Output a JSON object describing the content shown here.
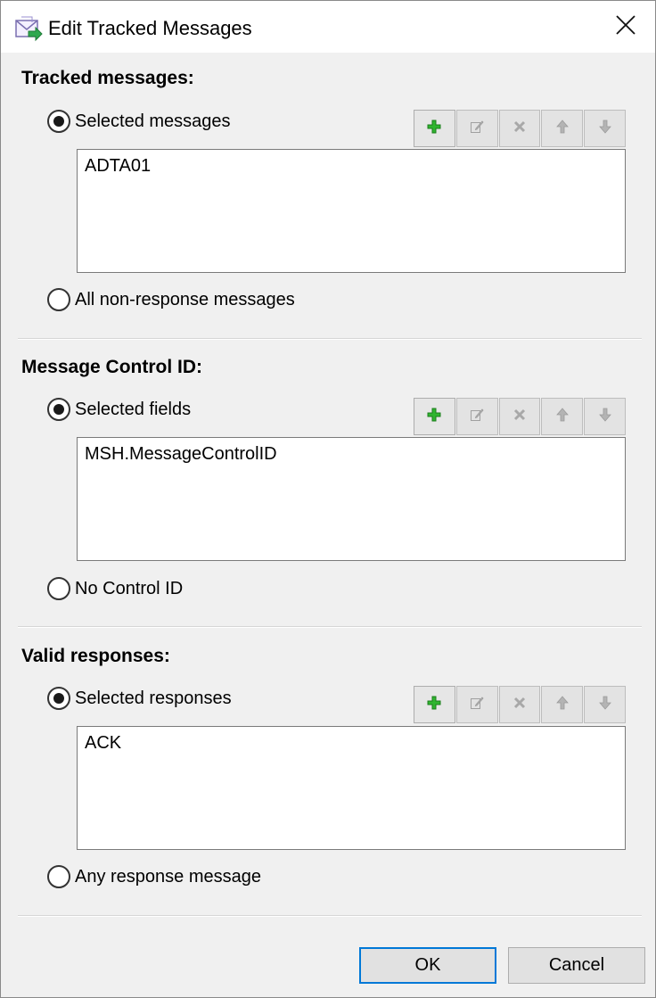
{
  "window": {
    "title": "Edit Tracked Messages"
  },
  "sections": [
    {
      "heading": "Tracked messages:",
      "options": [
        {
          "label": "Selected messages",
          "checked": true
        },
        {
          "label": "All non-response messages",
          "checked": false
        }
      ],
      "items": [
        "ADTA01"
      ]
    },
    {
      "heading": "Message Control ID:",
      "options": [
        {
          "label": "Selected fields",
          "checked": true
        },
        {
          "label": "No Control ID",
          "checked": false
        }
      ],
      "items": [
        "MSH.MessageControlID"
      ]
    },
    {
      "heading": "Valid responses:",
      "options": [
        {
          "label": "Selected responses",
          "checked": true
        },
        {
          "label": "Any response message",
          "checked": false
        }
      ],
      "items": [
        "ACK"
      ]
    }
  ],
  "toolbar": {
    "buttons": [
      {
        "icon": "add-icon",
        "enabled": true
      },
      {
        "icon": "edit-icon",
        "enabled": false
      },
      {
        "icon": "delete-icon",
        "enabled": false
      },
      {
        "icon": "move-up-icon",
        "enabled": false
      },
      {
        "icon": "move-down-icon",
        "enabled": false
      }
    ]
  },
  "footer": {
    "ok_label": "OK",
    "cancel_label": "Cancel"
  },
  "colors": {
    "accent": "#0078d7",
    "add_green": "#2fb52f",
    "disabled_icon": "#a0a0a0"
  }
}
